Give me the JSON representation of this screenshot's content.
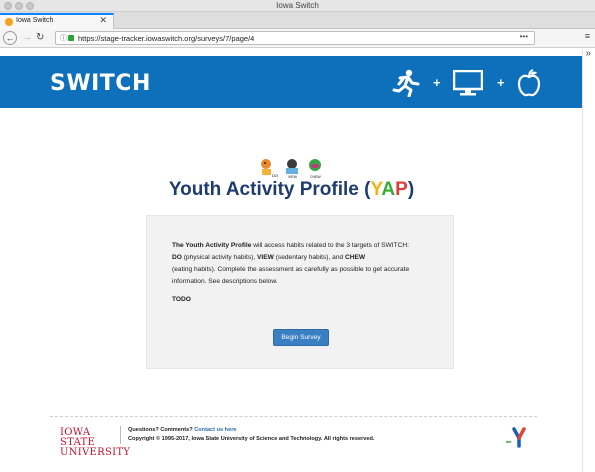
{
  "window": {
    "title": "Iowa Switch"
  },
  "tab": {
    "title": "Iowa Switch",
    "close": "✕"
  },
  "nav": {
    "url": "https://stage-tracker.iowaswitch.org/surveys/7/page/4",
    "page_actions": "•••"
  },
  "banner": {
    "logo": "SWITCH",
    "plus": "+"
  },
  "art": {
    "do": "DO",
    "view": "VIEW",
    "chew": "CHEW"
  },
  "main": {
    "title_prefix": "Youth Activity Profile (",
    "title_y": "Y",
    "title_a": "A",
    "title_p": "P",
    "title_suffix": ")",
    "desc_strong1": "The Youth Activity Profile",
    "desc_text1": " will access habits related to the 3 targets of SWITCH:",
    "desc_strong2": "DO",
    "desc_text2": " (physical activity habits), ",
    "desc_strong3": "VIEW",
    "desc_text3": " (sedentary habits), and ",
    "desc_strong4": "CHEW",
    "desc_text4": "(eating habits). Complete the assessment as carefully as possible to get accurate",
    "desc_text5": " information. See descriptions below.",
    "todo": "TODO",
    "begin_button": "Begin Survey"
  },
  "footer": {
    "isu_line1": "IOWA STATE",
    "isu_line2": "UNIVERSITY",
    "questions": "Questions? Comments? ",
    "contact_link": "Contact us here",
    "copyright": "Copyright © 1995-2017, Iowa State University of Science and Technology. All rights reserved."
  },
  "colors": {
    "banner": "#0e6fba",
    "title": "#1f3c70",
    "button": "#3a7fc2",
    "isu_red": "#c8102e"
  }
}
